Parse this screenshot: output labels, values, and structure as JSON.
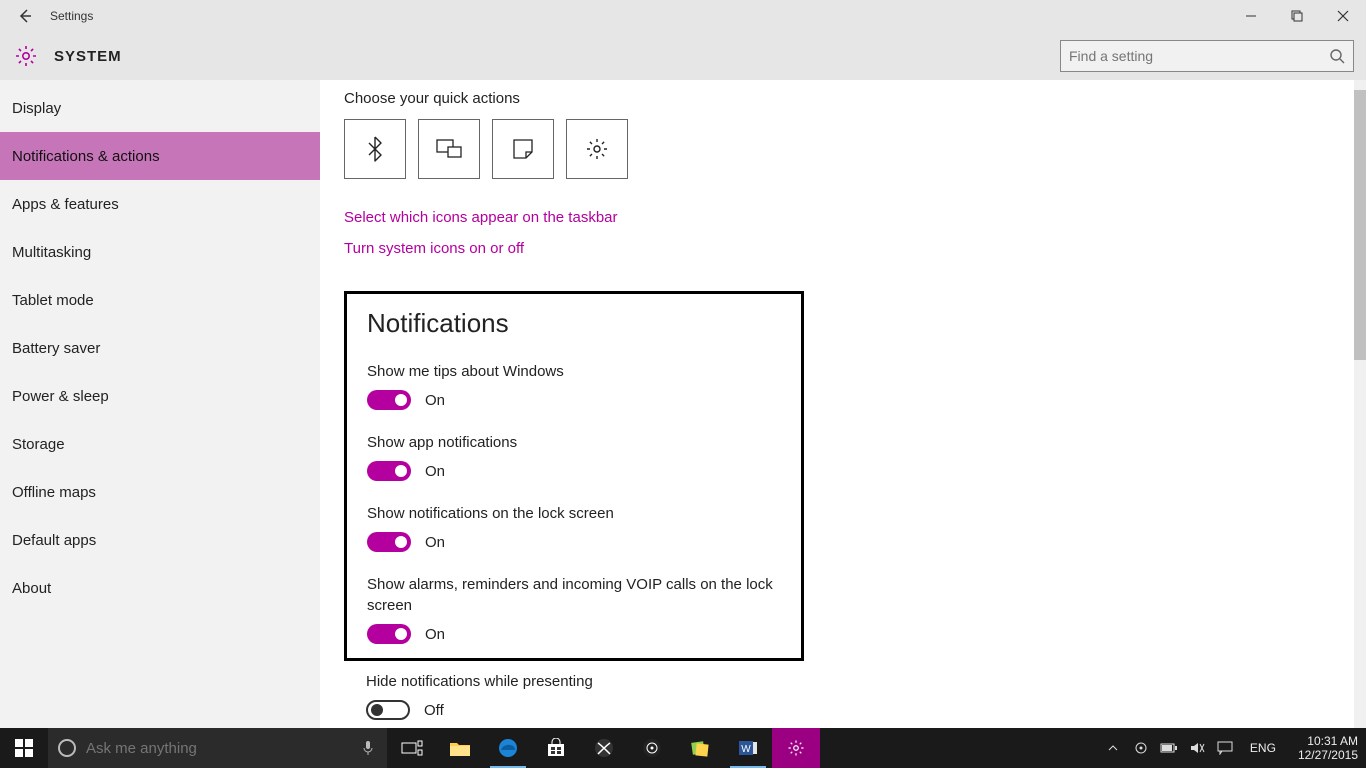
{
  "titlebar": {
    "title": "Settings"
  },
  "header": {
    "breadcrumb": "SYSTEM",
    "search_placeholder": "Find a setting"
  },
  "sidebar": {
    "items": [
      {
        "label": "Display"
      },
      {
        "label": "Notifications & actions"
      },
      {
        "label": "Apps & features"
      },
      {
        "label": "Multitasking"
      },
      {
        "label": "Tablet mode"
      },
      {
        "label": "Battery saver"
      },
      {
        "label": "Power & sleep"
      },
      {
        "label": "Storage"
      },
      {
        "label": "Offline maps"
      },
      {
        "label": "Default apps"
      },
      {
        "label": "About"
      }
    ],
    "selected_index": 1
  },
  "content": {
    "quick_actions_label": "Choose your quick actions",
    "quick_actions": [
      {
        "name": "bluetooth"
      },
      {
        "name": "project"
      },
      {
        "name": "note"
      },
      {
        "name": "settings"
      }
    ],
    "links": [
      "Select which icons appear on the taskbar",
      "Turn system icons on or off"
    ],
    "notifications_heading": "Notifications",
    "toggles": [
      {
        "label": "Show me tips about Windows",
        "state": "On",
        "on": true
      },
      {
        "label": "Show app notifications",
        "state": "On",
        "on": true
      },
      {
        "label": "Show notifications on the lock screen",
        "state": "On",
        "on": true
      },
      {
        "label": "Show alarms, reminders and incoming VOIP calls on the lock screen",
        "state": "On",
        "on": true
      }
    ],
    "toggle_after": {
      "label": "Hide notifications while presenting",
      "state": "Off",
      "on": false
    }
  },
  "taskbar": {
    "search_placeholder": "Ask me anything",
    "lang": "ENG",
    "time": "10:31 AM",
    "date": "12/27/2015"
  }
}
